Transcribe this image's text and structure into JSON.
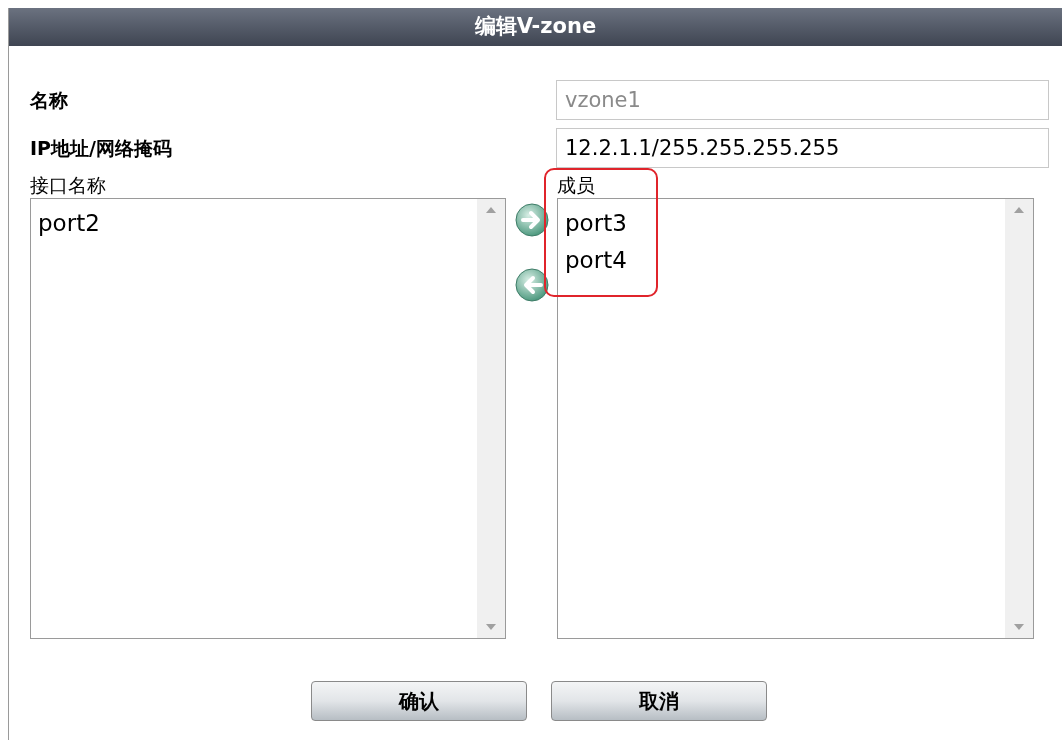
{
  "dialog": {
    "title": "编辑V-zone"
  },
  "fields": [
    {
      "label": "名称",
      "value": "vzone1",
      "disabled": true
    },
    {
      "label": "IP地址/网络掩码",
      "value": "12.2.1.1/255.255.255.255",
      "disabled": false
    }
  ],
  "available": {
    "label": "接口名称",
    "items": [
      "port2"
    ]
  },
  "members": {
    "label": "成员",
    "items": [
      "port3",
      "port4"
    ]
  },
  "buttons": [
    "确认",
    "取消"
  ]
}
